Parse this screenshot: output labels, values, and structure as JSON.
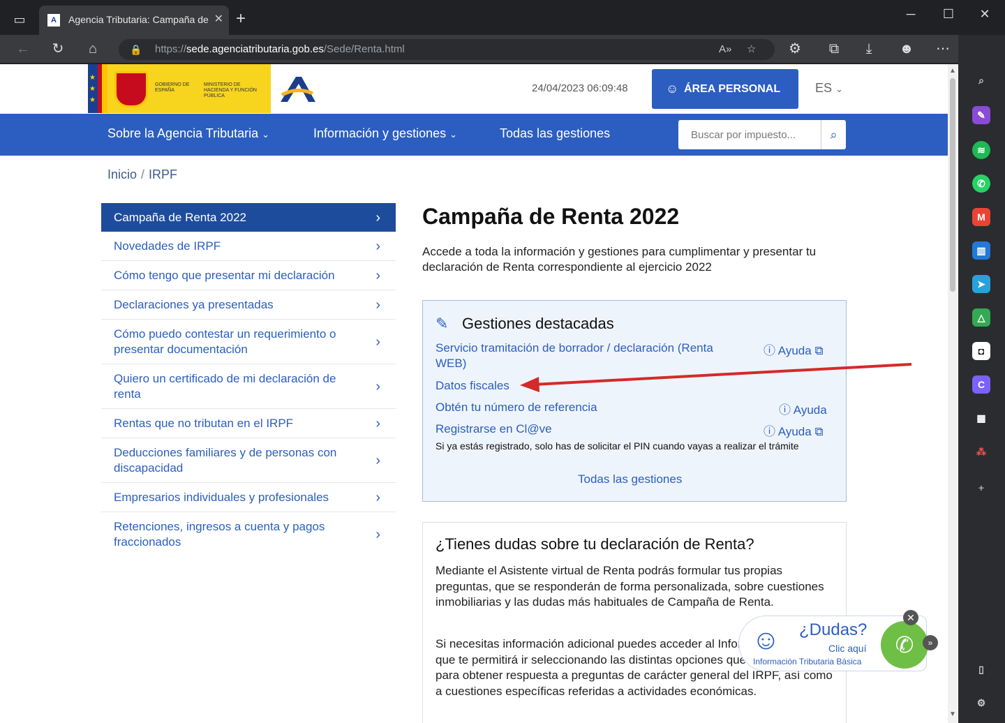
{
  "browser": {
    "tab_title": "Agencia Tributaria: Campaña de",
    "url_prefix": "https://",
    "url_domain": "sede.agenciatributaria.gob.es",
    "url_path": "/Sede/Renta.html"
  },
  "header": {
    "gov_label": "GOBIERNO DE ESPAÑA",
    "ministry_label": "MINISTERIO DE HACIENDA Y FUNCIÓN PÚBLICA",
    "datetime": "24/04/2023 06:09:48",
    "area_personal": "ÁREA PERSONAL",
    "language": "ES"
  },
  "nav": {
    "items": [
      "Sobre la Agencia Tributaria",
      "Información y gestiones",
      "Todas las gestiones"
    ],
    "search_placeholder": "Buscar por impuesto..."
  },
  "breadcrumb": [
    "Inicio",
    "IRPF"
  ],
  "menu": [
    "Campaña de Renta 2022",
    "Novedades de IRPF",
    "Cómo tengo que presentar mi declaración",
    "Declaraciones ya presentadas",
    "Cómo puedo contestar un requerimiento o presentar documentación",
    "Quiero un certificado de mi declaración de renta",
    "Rentas que no tributan en el IRPF",
    "Deducciones familiares y de personas con discapacidad",
    "Empresarios individuales y profesionales",
    "Retenciones, ingresos a cuenta y pagos fraccionados"
  ],
  "main": {
    "title": "Campaña de Renta 2022",
    "intro": "Accede a toda la información y gestiones para cumplimentar y presentar tu declaración de Renta correspondiente al ejercicio 2022",
    "box": {
      "title": "Gestiones destacadas",
      "link1": "Servicio tramitación de borrador / declaración (Renta WEB)",
      "link2": "Datos fiscales",
      "link3": "Obtén tu número de referencia",
      "link4": "Registrarse en Cl@ve",
      "help": "Ayuda",
      "note": "Si ya estás registrado, solo has de solicitar el PIN cuando vayas a realizar el trámite",
      "all": "Todas las gestiones"
    },
    "box2": {
      "title": "¿Tienes dudas sobre tu declaración de Renta?",
      "p1": "Mediante el Asistente virtual de Renta podrás formular tus propias preguntas, que se responderán de forma personalizada, sobre cuestiones inmobiliarias y las dudas más habituales de Campaña de Renta.",
      "p2": "Si necesitas información adicional puedes acceder al Informador de Renta, que te permitirá ir seleccionando las distintas opciones que te mostrarán para obtener respuesta a preguntas de carácter general del IRPF, así como a cuestiones específicas referidas a actividades económicas."
    }
  },
  "chat": {
    "title": "¿Dudas?",
    "cta": "Clic aquí",
    "subtitle": "Información Tributaria Básica"
  },
  "colors": {
    "primary": "#2b5ec0",
    "active_menu": "#1e4c9c",
    "arrow": "#d42a2a"
  }
}
